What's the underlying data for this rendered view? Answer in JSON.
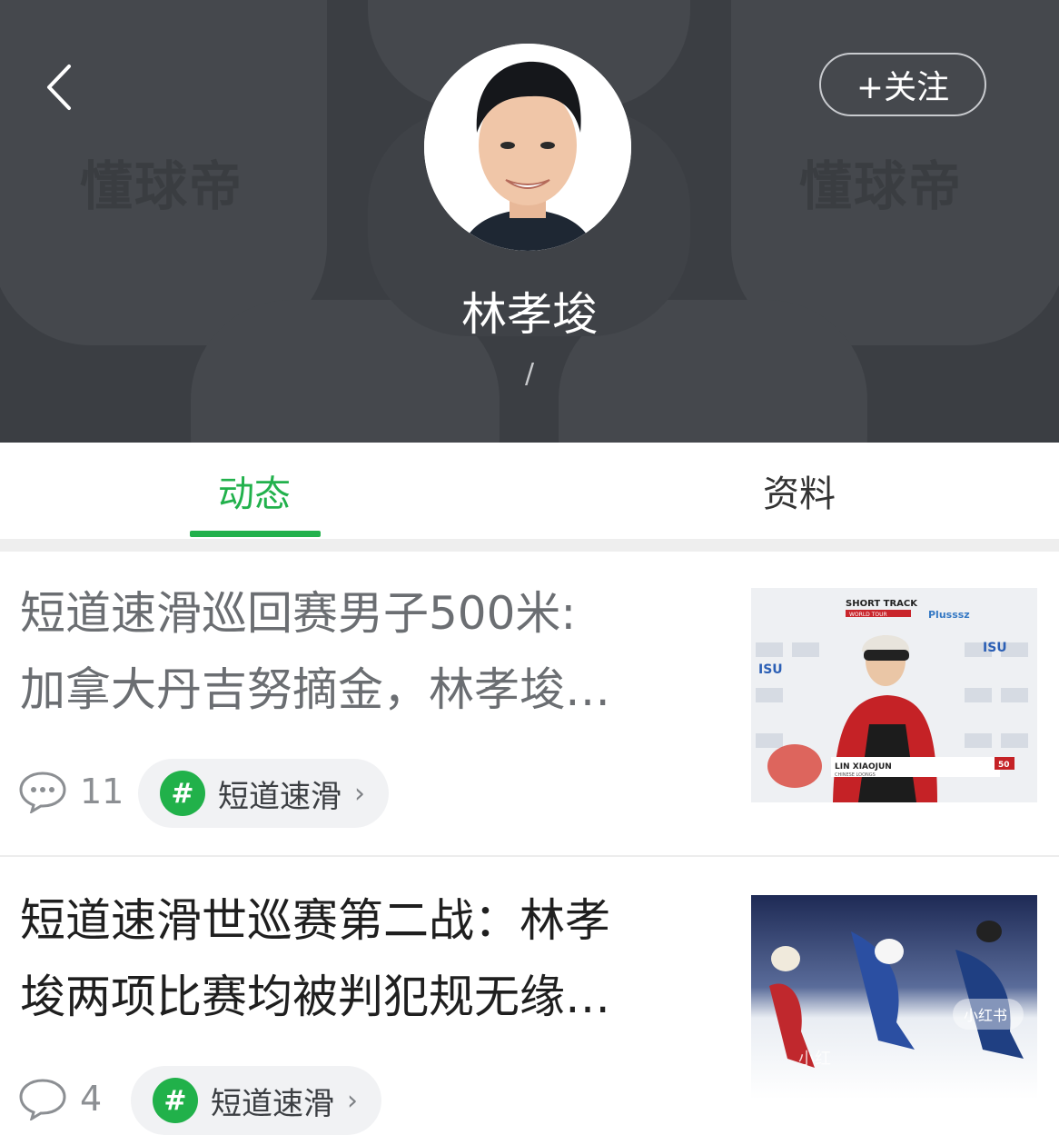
{
  "header": {
    "watermark_text": "懂球帝",
    "follow_label": "+关注",
    "player_name": "林孝埈",
    "subtitle": "/"
  },
  "tabs": [
    {
      "label": "动态",
      "active": true
    },
    {
      "label": "资料",
      "active": false
    }
  ],
  "feed": [
    {
      "title_line1": "短道速滑巡回赛男子500米:",
      "title_line2": "加拿大丹吉努摘金，林孝埈…",
      "comments": "11",
      "topic": "短道速滑",
      "thumb_text": {
        "brand": "SHORT TRACK",
        "brand_sub": "WORLD TOUR",
        "sponsor": "Plusssz",
        "isu": "ISU",
        "caption_name": "LIN XIAOJUN",
        "caption_team": "CHINESE LOONGS",
        "bib": "50"
      }
    },
    {
      "title_line1": "短道速滑世巡赛第二战：林孝",
      "title_line2": "埈两项比赛均被判犯规无缘…",
      "comments": "4",
      "topic": "短道速滑",
      "thumb_text": {
        "watermark": "小红书",
        "watermark2": "小红"
      }
    }
  ],
  "colors": {
    "accent_green": "#22b14c",
    "header_bg": "#3b3e43",
    "title_grey": "#6b6e72",
    "title_dark": "#1f1f1f"
  },
  "icons": {
    "back": "chevron-left-icon",
    "comment": "comment-bubble-icon",
    "topic": "hash-icon",
    "topic_arrow": "chevron-right-icon"
  }
}
